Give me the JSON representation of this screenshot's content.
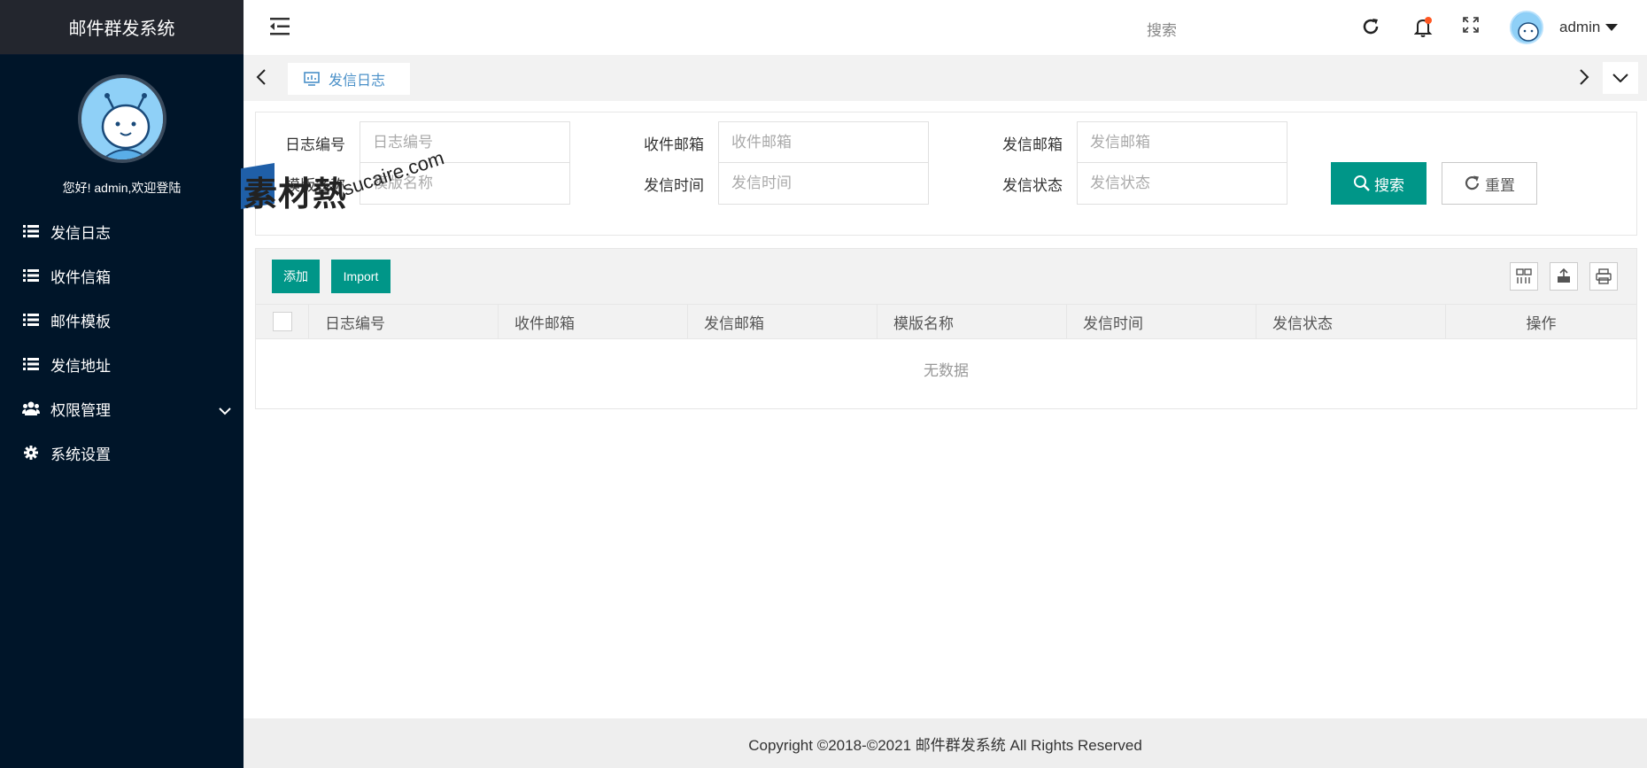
{
  "app": {
    "title": "邮件群发系统",
    "welcome": "您好! admin,欢迎登陆"
  },
  "sidebar": {
    "items": [
      {
        "label": "发信日志",
        "icon": "list-icon"
      },
      {
        "label": "收件信箱",
        "icon": "list-icon"
      },
      {
        "label": "邮件模板",
        "icon": "list-icon"
      },
      {
        "label": "发信地址",
        "icon": "list-icon"
      },
      {
        "label": "权限管理",
        "icon": "users-icon",
        "expandable": true
      },
      {
        "label": "系统设置",
        "icon": "gear-icon"
      }
    ]
  },
  "header": {
    "search_label": "搜索",
    "user": "admin"
  },
  "tabs": {
    "active": "发信日志"
  },
  "filters": {
    "log_id": {
      "label": "日志编号",
      "placeholder": "日志编号"
    },
    "to_email": {
      "label": "收件邮箱",
      "placeholder": "收件邮箱"
    },
    "from_email": {
      "label": "发信邮箱",
      "placeholder": "发信邮箱"
    },
    "template": {
      "label": "模版名称",
      "placeholder": "模版名称"
    },
    "send_time": {
      "label": "发信时间",
      "placeholder": "发信时间"
    },
    "status": {
      "label": "发信状态",
      "placeholder": "发信状态"
    },
    "search_button": "搜索",
    "reset_button": "重置"
  },
  "toolbar": {
    "add_label": "添加",
    "import_label": "Import"
  },
  "table": {
    "columns": [
      "日志编号",
      "收件邮箱",
      "发信邮箱",
      "模版名称",
      "发信时间",
      "发信状态",
      "操作"
    ],
    "empty_text": "无数据"
  },
  "footer": {
    "copyright": "Copyright ©2018-©2021 邮件群发系统 All Rights Reserved"
  },
  "watermark": {
    "text": "素材熱",
    "sub": "sucaire.com"
  },
  "colors": {
    "sidebar_bg": "#001529",
    "accent": "#009688",
    "tab_text": "#4a90c8",
    "notification_dot": "#ff5722"
  }
}
